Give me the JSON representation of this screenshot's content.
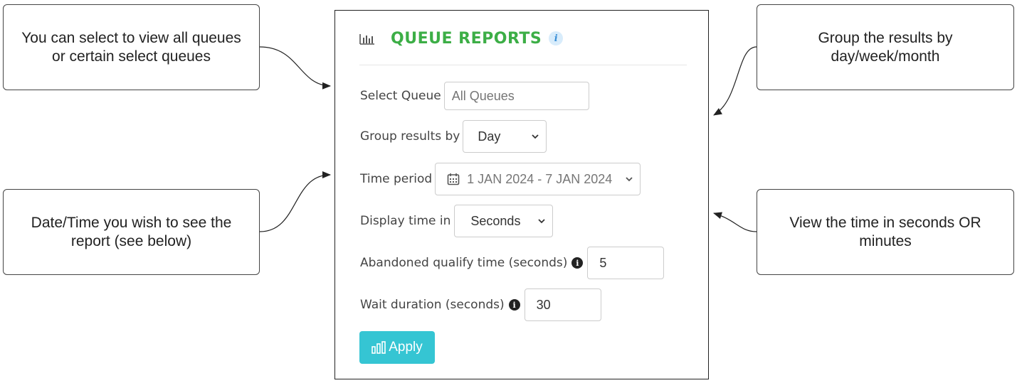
{
  "callouts": {
    "queues": "You can select to view all queues or certain select queues",
    "group": "Group the results by day/week/month",
    "date": "Date/Time you wish to see the report (see below)",
    "display": "View the time in seconds OR minutes"
  },
  "panel": {
    "title": "QUEUE REPORTS",
    "title_icon": "bar-chart-icon",
    "info_badge": "i",
    "title_color": "#3cae46"
  },
  "form": {
    "select_queue": {
      "label": "Select Queue",
      "placeholder": "All Queues"
    },
    "group_by": {
      "label": "Group results by",
      "value": "Day"
    },
    "time_period": {
      "label": "Time period",
      "value": "1 JAN 2024 - 7 JAN 2024",
      "icon": "calendar-icon"
    },
    "display_time": {
      "label": "Display time in",
      "value": "Seconds"
    },
    "abandoned": {
      "label": "Abandoned qualify time (seconds)",
      "value": "5",
      "info": "i"
    },
    "wait": {
      "label": "Wait duration (seconds)",
      "value": "30",
      "info": "i"
    }
  },
  "apply": {
    "label": "Apply",
    "color": "#35c5d3",
    "icon": "bar-chart-icon"
  }
}
